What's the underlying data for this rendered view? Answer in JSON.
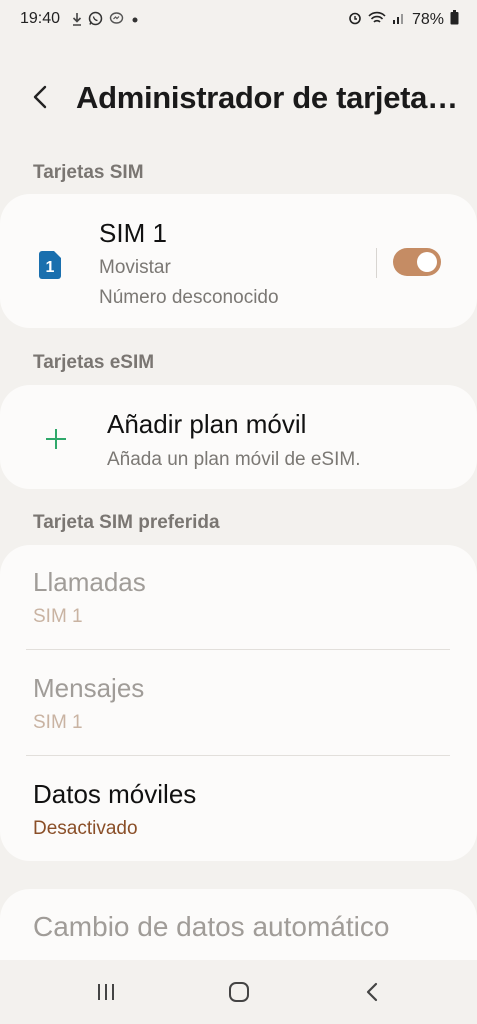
{
  "status_bar": {
    "time": "19:40",
    "battery": "78%",
    "icons_left": [
      "download-icon",
      "whatsapp-icon",
      "messenger-icon",
      "dot-icon"
    ],
    "icons_right": [
      "alarm-icon",
      "wifi-icon",
      "signal-icon",
      "battery-icon"
    ]
  },
  "header": {
    "title": "Administrador de tarjetas SIM"
  },
  "sections": {
    "sim": "Tarjetas SIM",
    "esim": "Tarjetas eSIM",
    "preferred": "Tarjeta SIM preferida"
  },
  "sim_card": {
    "badge": "1",
    "name": "SIM 1",
    "carrier": "Movistar",
    "number": "Número desconocido",
    "enabled": true,
    "accent_color": "#c58c64",
    "icon_color": "#1a6fae"
  },
  "esim_card": {
    "title": "Añadir plan móvil",
    "subtitle": "Añada un plan móvil de eSIM.",
    "plus_color": "#2fa86a"
  },
  "preferred": {
    "calls_label": "Llamadas",
    "calls_value": "SIM 1",
    "messages_label": "Mensajes",
    "messages_value": "SIM 1",
    "data_label": "Datos móviles",
    "data_value": "Desactivado"
  },
  "auto_switch": {
    "label": "Cambio de datos automático"
  }
}
